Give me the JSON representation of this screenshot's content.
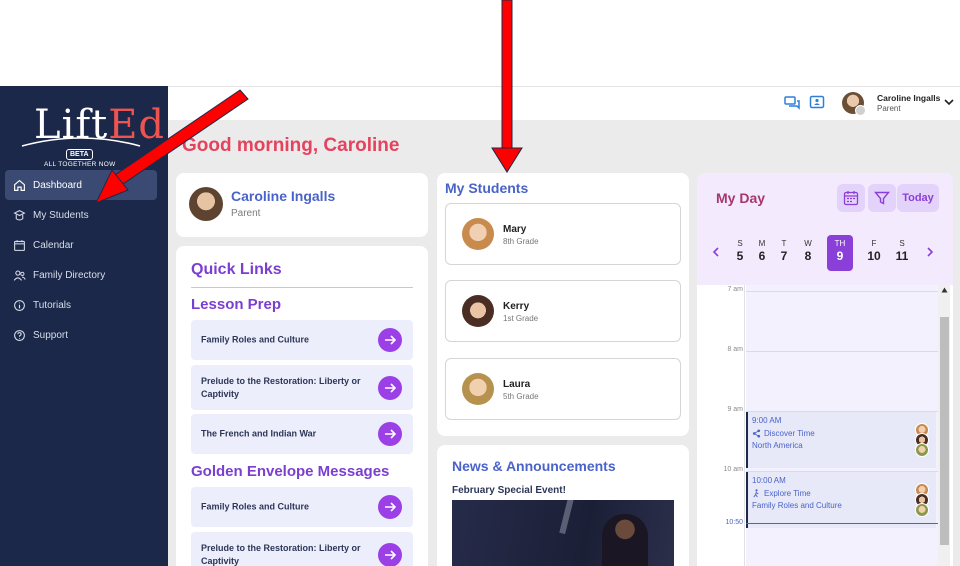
{
  "brand": {
    "name_part1": "Lift",
    "name_part2": "Ed",
    "badge": "BETA",
    "tagline": "ALL TOGETHER NOW"
  },
  "sidebar": {
    "items": [
      {
        "label": "Dashboard",
        "icon": "home-icon",
        "active": true
      },
      {
        "label": "My Students",
        "icon": "students-icon"
      },
      {
        "label": "Calendar",
        "icon": "calendar-icon"
      },
      {
        "label": "Family Directory",
        "icon": "people-icon"
      },
      {
        "label": "Tutorials",
        "icon": "info-icon"
      },
      {
        "label": "Support",
        "icon": "help-icon"
      }
    ]
  },
  "topbar": {
    "user_name": "Caroline Ingalls",
    "user_role": "Parent"
  },
  "greeting": "Good morning, Caroline",
  "profile": {
    "name": "Caroline Ingalls",
    "role": "Parent"
  },
  "quick_links": {
    "title": "Quick Links",
    "lesson_prep_title": "Lesson Prep",
    "lesson_prep": [
      "Family Roles and Culture",
      "Prelude to the Restoration: Liberty or Captivity",
      "The French and Indian War"
    ],
    "golden_title": "Golden Envelope Messages",
    "golden": [
      "Family Roles and Culture",
      "Prelude to the Restoration: Liberty or Captivity"
    ]
  },
  "students": {
    "title": "My Students",
    "list": [
      {
        "name": "Mary",
        "grade": "8th Grade"
      },
      {
        "name": "Kerry",
        "grade": "1st Grade"
      },
      {
        "name": "Laura",
        "grade": "5th Grade"
      }
    ]
  },
  "news": {
    "title": "News & Announcements",
    "headline": "February Special Event!"
  },
  "my_day": {
    "title": "My Day",
    "today_label": "Today",
    "week": [
      {
        "letter": "S",
        "num": "5"
      },
      {
        "letter": "M",
        "num": "6"
      },
      {
        "letter": "T",
        "num": "7"
      },
      {
        "letter": "W",
        "num": "8"
      },
      {
        "letter": "TH",
        "num": "9",
        "active": true
      },
      {
        "letter": "F",
        "num": "10"
      },
      {
        "letter": "S",
        "num": "11"
      }
    ],
    "hours": [
      "7 am",
      "8 am",
      "9 am",
      "10 am"
    ],
    "now_label": "10:50",
    "events": [
      {
        "time": "9:00 AM",
        "activity": "Discover Time",
        "topic": "North America"
      },
      {
        "time": "10:00 AM",
        "activity": "Explore Time",
        "topic": "Family Roles and Culture"
      }
    ]
  },
  "colors": {
    "sidebar": "#1c2849",
    "accent_purple": "#9b3fe6",
    "greeting_red": "#e5425e",
    "title_blue": "#4a63c8",
    "annotation_red": "#ff0000"
  }
}
